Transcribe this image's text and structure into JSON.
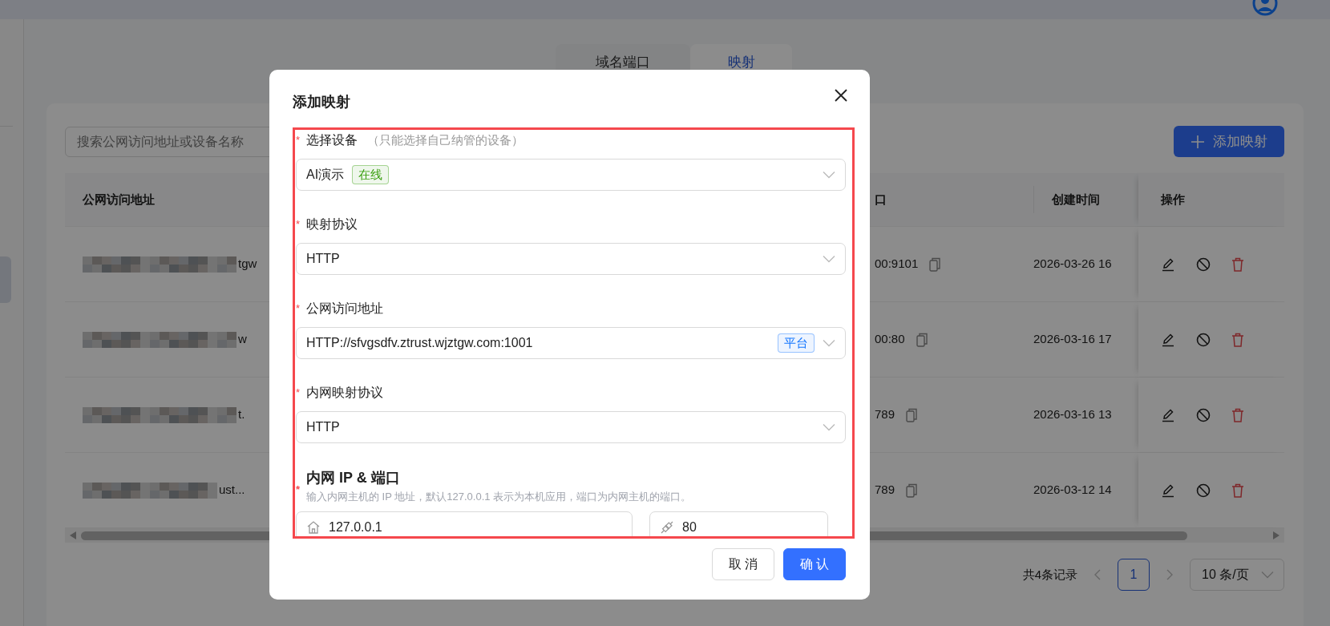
{
  "tabs": [
    {
      "label": "域名端口",
      "selected": false
    },
    {
      "label": "映射",
      "selected": true
    }
  ],
  "search": {
    "placeholder": "搜索公网访问地址或设备名称"
  },
  "add_button": {
    "label": "添加映射"
  },
  "table": {
    "columns": [
      "公网访问地址",
      "口",
      "创建时间",
      "操作"
    ],
    "rows": [
      {
        "address": "tgw",
        "column_3": "00:9101",
        "created": "2026-03-26 16"
      },
      {
        "address": "w",
        "column_3": "00:80",
        "created": "2026-03-16 17"
      },
      {
        "address": "t.",
        "column_3": "789",
        "created": "2026-03-16 13"
      },
      {
        "address": "ust...",
        "column_3": "789",
        "created": "2026-03-12 14"
      }
    ]
  },
  "pagination": {
    "total": "共4条记录",
    "pages": [
      {
        "label": "1",
        "selected": true
      }
    ],
    "page_size": "10 条/页"
  },
  "dialog": {
    "title": "添加映射",
    "fields": [
      {
        "kind": "select",
        "required_mark": "*",
        "label": "选择设备",
        "hint": "（只能选择自己纳管的设备）",
        "value": "AI演示",
        "tag": {
          "text": "在线",
          "color": "#389e0d"
        }
      },
      {
        "kind": "select",
        "required_mark": "*",
        "label": "映射协议",
        "value": "HTTP"
      },
      {
        "kind": "select",
        "required_mark": "*",
        "label": "公网访问地址",
        "value": "HTTP://sfvgsdfv.ztrust.wjztgw.com:1001",
        "tag": {
          "text": "平台",
          "color": "#1677ff"
        }
      },
      {
        "kind": "select",
        "required_mark": "*",
        "label": "内网映射协议",
        "value": "HTTP"
      },
      {
        "kind": "pair",
        "required_mark": "*",
        "label": "内网 IP & 端口",
        "description": "输入内网主机的 IP 地址，默认127.0.0.1 表示为本机应用，端口为内网主机的端口。",
        "inputs": [
          {
            "value": "127.0.0.1"
          },
          {
            "value": "80"
          }
        ]
      }
    ],
    "buttons": [
      {
        "label": "取 消",
        "kind": "default"
      },
      {
        "label": "确 认",
        "kind": "primary"
      }
    ]
  }
}
